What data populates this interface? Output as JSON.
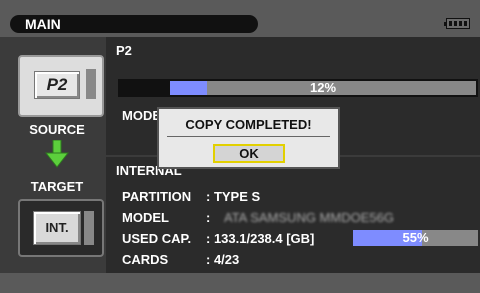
{
  "topbar": {
    "title": "MAIN"
  },
  "source": {
    "card_label": "P2",
    "label": "SOURCE"
  },
  "target": {
    "card_label": "INT.",
    "label": "TARGET"
  },
  "p2_panel": {
    "heading": "P2",
    "progress": {
      "value_percent": 12,
      "text": "12%"
    },
    "model_label": "MODE"
  },
  "internal_panel": {
    "heading": "INTERNAL",
    "rows": [
      {
        "key": "PARTITION",
        "value": ": TYPE S"
      },
      {
        "key": "MODEL",
        "value": ":",
        "blurred": "ATA      SAMSUNG MMDOE56G"
      },
      {
        "key": "USED CAP.",
        "value": ": 133.1/238.4 [GB]"
      },
      {
        "key": "CARDS",
        "value": ": 4/23"
      }
    ],
    "used_bar": {
      "value_percent": 55,
      "text": "55%"
    }
  },
  "dialog": {
    "message": "COPY COMPLETED!",
    "ok_label": "OK"
  },
  "colors": {
    "bar_fill": "#7e8cff",
    "ok_border": "#e2d000",
    "arrow": "#5ccf3c"
  }
}
